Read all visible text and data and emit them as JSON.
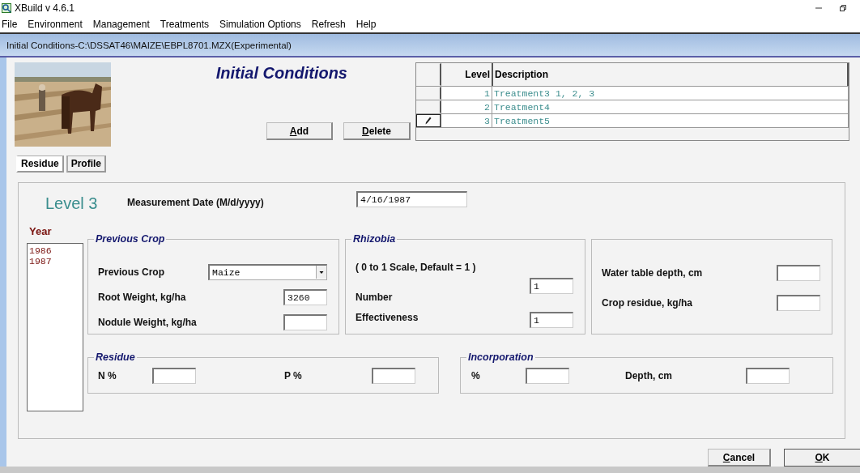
{
  "app": {
    "title": "XBuild v 4.6.1"
  },
  "menu": [
    "File",
    "Environment",
    "Management",
    "Treatments",
    "Simulation Options",
    "Refresh",
    "Help"
  ],
  "dialog": {
    "title": "Initial Conditions-C:\\DSSAT46\\MAIZE\\EBPL8701.MZX(Experimental)"
  },
  "heading": "Initial Conditions",
  "actions": [
    "Add",
    "Delete"
  ],
  "levels_table": {
    "columns": [
      "Level",
      "Description"
    ],
    "rows": [
      {
        "level": "1",
        "description": "Treatment3 1, 2, 3",
        "current": false
      },
      {
        "level": "2",
        "description": "Treatment4",
        "current": false
      },
      {
        "level": "3",
        "description": "Treatment5",
        "current": true
      }
    ]
  },
  "tabs": [
    {
      "label": "Residue",
      "selected": true
    },
    {
      "label": "Profile",
      "selected": false
    }
  ],
  "level_title": "Level 3",
  "measurement_date": {
    "label": "Measurement Date (M/d/yyyy)",
    "value": "4/16/1987"
  },
  "year": {
    "label": "Year",
    "items": [
      "1986",
      "1987"
    ]
  },
  "previous_crop": {
    "title": "Previous Crop",
    "crop_label": "Previous Crop",
    "crop_value": "Maize",
    "root_label": "Root Weight, kg/ha",
    "root_value": "3260",
    "nodule_label": "Nodule Weight, kg/ha"
  },
  "rhizobia": {
    "title": "Rhizobia",
    "scale": "( 0 to 1 Scale, Default = 1 )",
    "number_label": "Number",
    "number_value": "1",
    "effectiveness_label": "Effectiveness",
    "effectiveness_value": "1"
  },
  "water": {
    "water_label": "Water table depth, cm",
    "residue_label": "Crop residue, kg/ha"
  },
  "residue": {
    "title": "Residue",
    "n_label": "N %",
    "p_label": "P %"
  },
  "incorporation": {
    "title": "Incorporation",
    "pct_label": "%",
    "depth_label": "Depth, cm"
  },
  "footer": [
    "Cancel",
    "OK"
  ]
}
